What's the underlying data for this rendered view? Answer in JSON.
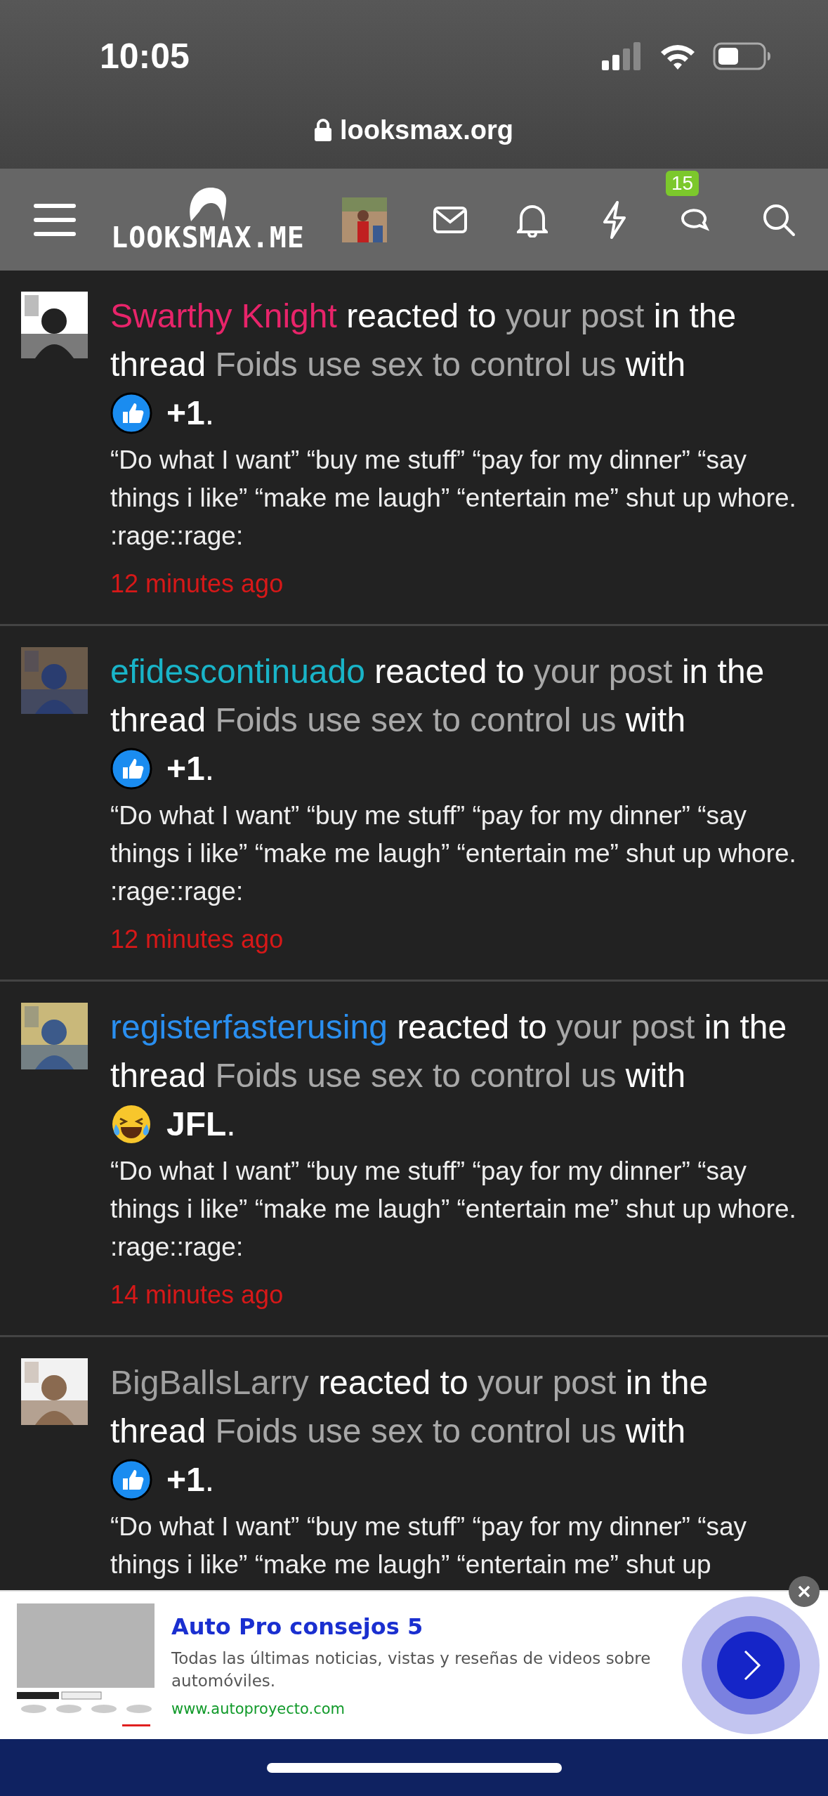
{
  "status_bar": {
    "time": "10:05"
  },
  "address_bar": {
    "url": "looksmax.org"
  },
  "nav": {
    "logo": "LOOKSMAX.ME",
    "conversations_badge": "15"
  },
  "alerts": [
    {
      "user": "Swarthy Knight",
      "color": "#e8246a",
      "verb": "reacted to",
      "link": "your post",
      "mid": "in the thread",
      "thread": "Foids use sex to control us",
      "with": "with",
      "reaction": {
        "kind": "like",
        "label": "+1",
        "end": "."
      },
      "snippet": "“Do what I want” “buy me stuff” “pay for my dinner” “say things i like” “make me laugh” “entertain me” shut up whore. :rage::rage:",
      "time": "12 minutes ago"
    },
    {
      "user": "efidescontinuado",
      "color": "#19b4c8",
      "verb": "reacted to",
      "link": "your post",
      "mid": "in the thread",
      "thread": "Foids use sex to control us",
      "with": "with",
      "reaction": {
        "kind": "like",
        "label": "+1",
        "end": "."
      },
      "snippet": "“Do what I want” “buy me stuff” “pay for my dinner” “say things i like” “make me laugh” “entertain me” shut up whore. :rage::rage:",
      "time": "12 minutes ago"
    },
    {
      "user": "registerfasterusing",
      "color": "#2a8ff0",
      "verb": "reacted to",
      "link": "your post",
      "mid": "in the thread",
      "thread": "Foids use sex to control us",
      "with": "with",
      "reaction": {
        "kind": "laugh",
        "label": "JFL",
        "end": "."
      },
      "snippet": "“Do what I want” “buy me stuff” “pay for my dinner” “say things i like” “make me laugh” “entertain me” shut up whore. :rage::rage:",
      "time": "14 minutes ago"
    },
    {
      "user": "BigBallsLarry",
      "color": "#a0a0a0",
      "verb": "reacted to",
      "link": "your post",
      "mid": "in the thread",
      "thread": "Foids use sex to control us",
      "with": "with",
      "reaction": {
        "kind": "like",
        "label": "+1",
        "end": "."
      },
      "snippet": "“Do what I want” “buy me stuff” “pay for my dinner” “say things i like” “make me laugh” “entertain me” shut up"
    }
  ],
  "ad": {
    "title": "Auto Pro consejos 5",
    "text": "Todas las últimas noticias, vistas y reseñas de videos sobre automóviles.",
    "url": "www.autoproyecto.com"
  }
}
